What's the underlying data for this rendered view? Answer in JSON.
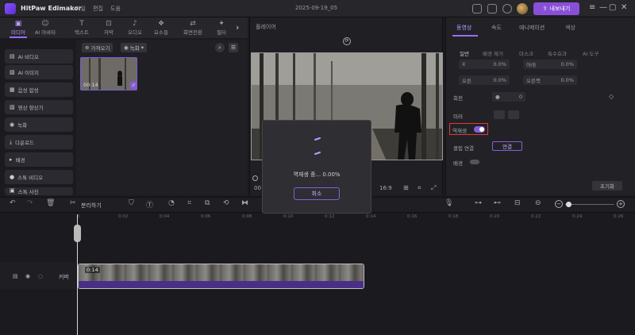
{
  "app": {
    "name": "HitPaw Edimakor",
    "title": "2025-09-19_05",
    "menus": [
      "파일",
      "편집",
      "도움"
    ],
    "export_label": "내보내기"
  },
  "tabs": [
    {
      "label": "미디어",
      "icon": "media-icon"
    },
    {
      "label": "AI 아바타",
      "icon": "avatar-icon"
    },
    {
      "label": "텍스트",
      "icon": "text-icon"
    },
    {
      "label": "자막",
      "icon": "subtitle-icon"
    },
    {
      "label": "오디오",
      "icon": "audio-icon"
    },
    {
      "label": "요소들",
      "icon": "elements-icon"
    },
    {
      "label": "화면전환",
      "icon": "transition-icon"
    },
    {
      "label": "필터",
      "icon": "filter-icon"
    }
  ],
  "left_items": [
    {
      "label": "AI 비디오",
      "icon": "ai-video-icon"
    },
    {
      "label": "AI 이미지",
      "icon": "ai-image-icon"
    },
    {
      "label": "음성 합성",
      "icon": "speech-icon"
    },
    {
      "label": "영상 향상기",
      "icon": "enhance-icon"
    },
    {
      "label": "녹화",
      "icon": "record-icon"
    },
    {
      "label": "다운로드",
      "icon": "download-icon"
    },
    {
      "label": "배경",
      "icon": "background-icon"
    },
    {
      "label": "스톡 비디오",
      "icon": "stock-video-icon"
    },
    {
      "label": "스톡 사진",
      "icon": "stock-photo-icon"
    }
  ],
  "media": {
    "import_label": "가져오기",
    "record_label": "녹화",
    "thumb_duration": "00:14"
  },
  "player": {
    "label": "플레이어",
    "time": "00",
    "aspect": "16:9"
  },
  "right": {
    "tabs": [
      "동영상",
      "속도",
      "애니메이션",
      "색상"
    ],
    "subtabs": [
      "일반",
      "배경 제거",
      "마스크",
      "특수효과",
      "AI 도구"
    ],
    "fields": {
      "x_label": "X",
      "x_val": "0.0%",
      "y_label": "아래",
      "y_val": "0.0%",
      "z_label": "오른",
      "z_val": "0.0%",
      "w_label": "오른쪽",
      "w_val": "0.0%"
    },
    "rotate_label": "회전",
    "rotate_val": "0",
    "mirror_label": "미러",
    "reverse_label": "역재생",
    "clip_link_label": "클립 연결",
    "connect_label": "연결",
    "bg_label": "배경",
    "reset_label": "초기화"
  },
  "toolbar": {
    "split_label": "분리하기"
  },
  "ruler": [
    "0",
    "0:02",
    "0:04",
    "0:06",
    "0:08",
    "0:10",
    "0:12",
    "0:14",
    "0:16",
    "0:18",
    "0:20",
    "0:22",
    "0:24",
    "0:26"
  ],
  "track": {
    "label": "커버",
    "clip_time": "0:14"
  },
  "modal": {
    "progress_text": "역재생 중... 0.00%",
    "cancel_label": "취소",
    "progress": 0.0
  },
  "colors": {
    "accent": "#8a4fd8",
    "highlight": "#e23a3a"
  }
}
